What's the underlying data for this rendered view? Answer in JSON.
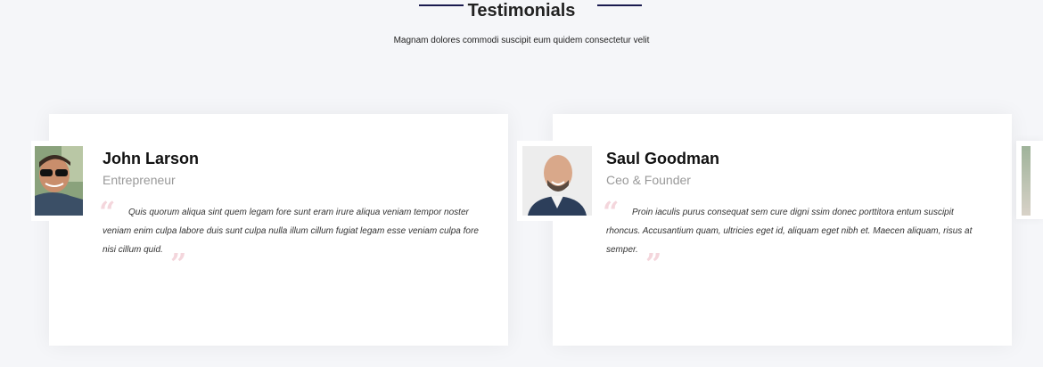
{
  "section": {
    "title": "Testimonials",
    "subtitle": "Magnam dolores commodi suscipit eum quidem consectetur velit"
  },
  "testimonials": [
    {
      "name": "John Larson",
      "role": "Entrepreneur",
      "quote": "Quis quorum aliqua sint quem legam fore sunt eram irure aliqua veniam tempor noster veniam enim culpa labore duis sunt culpa nulla illum cillum fugiat legam esse veniam culpa fore nisi cillum quid."
    },
    {
      "name": "Saul Goodman",
      "role": "Ceo & Founder",
      "quote": "Proin iaculis purus consequat sem cure digni ssim donec porttitora entum suscipit rhoncus. Accusantium quam, ultricies eget id, aliquam eget nibh et. Maecen aliquam, risus at semper."
    }
  ],
  "colors": {
    "accent_line": "#1a1a4f",
    "quote_mark": "#f4d6dc",
    "background": "#f5f6f9"
  }
}
